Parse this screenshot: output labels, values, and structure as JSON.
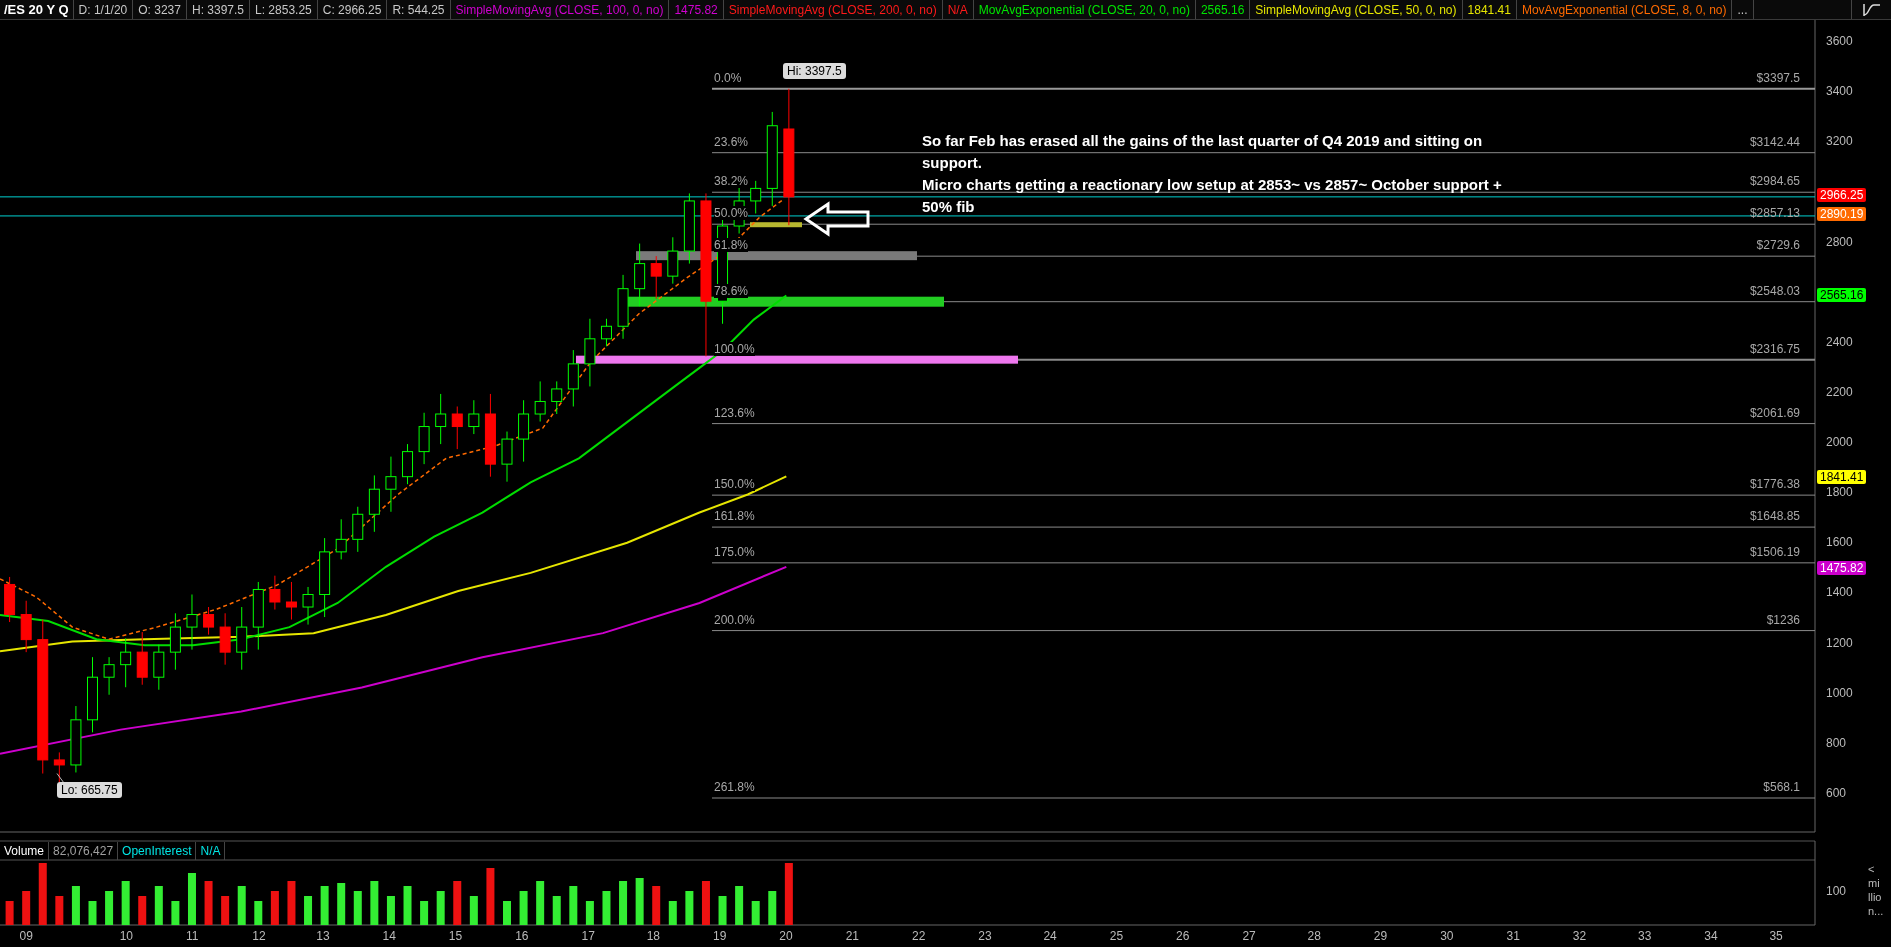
{
  "header": {
    "symbol": "/ES 20 Y Q",
    "items": [
      {
        "text": "D: 1/1/20",
        "color": "#c8c8c8"
      },
      {
        "text": "O: 3237",
        "color": "#c8c8c8"
      },
      {
        "text": "H: 3397.5",
        "color": "#c8c8c8"
      },
      {
        "text": "L: 2853.25",
        "color": "#c8c8c8"
      },
      {
        "text": "C: 2966.25",
        "color": "#c8c8c8"
      },
      {
        "text": "R: 544.25",
        "color": "#c8c8c8"
      },
      {
        "text": "SimpleMovingAvg (CLOSE, 100, 0, no)",
        "color": "#d000d0"
      },
      {
        "text": "1475.82",
        "color": "#d000d0"
      },
      {
        "text": "SimpleMovingAvg (CLOSE, 200, 0, no)",
        "color": "#ff1a1a"
      },
      {
        "text": "N/A",
        "color": "#ff1a1a"
      },
      {
        "text": "MovAvgExponential (CLOSE, 20, 0, no)",
        "color": "#00e600"
      },
      {
        "text": "2565.16",
        "color": "#00e600"
      },
      {
        "text": "SimpleMovingAvg (CLOSE, 50, 0, no)",
        "color": "#e6e600"
      },
      {
        "text": "1841.41",
        "color": "#e6e600"
      },
      {
        "text": "MovAvgExponential (CLOSE, 8, 0, no)",
        "color": "#ff6a00"
      }
    ],
    "more": "..."
  },
  "price_axis": {
    "ticks": [
      "3600",
      "3400",
      "3200",
      "2800",
      "2400",
      "2200",
      "2000",
      "1800",
      "1600",
      "1400",
      "1200",
      "1000",
      "800",
      "600"
    ]
  },
  "price_tags": [
    {
      "text": "2966.25",
      "color": "#ff0000"
    },
    {
      "text": "2890.19",
      "color": "#ff6a00"
    },
    {
      "text": "2565.16",
      "color": "#00ff00"
    },
    {
      "text": "1841.41",
      "color": "#ffff00"
    },
    {
      "text": "1475.82",
      "color": "#cc00cc"
    }
  ],
  "fib_levels": [
    {
      "percent": "0.0%",
      "price": "$3397.5"
    },
    {
      "percent": "23.6%",
      "price": "$3142.44"
    },
    {
      "percent": "38.2%",
      "price": "$2984.65"
    },
    {
      "percent": "50.0%",
      "price": "$2857.13"
    },
    {
      "percent": "61.8%",
      "price": "$2729.6"
    },
    {
      "percent": "78.6%",
      "price": "$2548.03"
    },
    {
      "percent": "100.0%",
      "price": "$2316.75"
    },
    {
      "percent": "123.6%",
      "price": "$2061.69"
    },
    {
      "percent": "150.0%",
      "price": "$1776.38"
    },
    {
      "percent": "161.8%",
      "price": "$1648.85"
    },
    {
      "percent": "175.0%",
      "price": "$1506.19"
    },
    {
      "percent": "200.0%",
      "price": "$1236"
    },
    {
      "percent": "261.8%",
      "price": "$568.1"
    }
  ],
  "labels": {
    "high": "Hi: 3397.5",
    "low": "Lo: 665.75"
  },
  "note": [
    "So far Feb has erased all the gains of the last quarter of Q4 2019 and sitting on support.",
    "Micro charts getting a reactionary low setup at 2853~ vs 2857~ October support + 50% fib"
  ],
  "volume": {
    "items": [
      {
        "text": "Volume",
        "color": "#ffffff"
      },
      {
        "text": "82,076,427",
        "color": "#a0a0a0"
      },
      {
        "text": "OpenInterest",
        "color": "#00e5e5"
      },
      {
        "text": "N/A",
        "color": "#00e5e5"
      }
    ],
    "axis_tick": "100",
    "unit": "<million..."
  },
  "time_axis": [
    "09",
    "10",
    "11",
    "12",
    "13",
    "14",
    "15",
    "16",
    "17",
    "18",
    "19",
    "20",
    "21",
    "22",
    "23",
    "24",
    "25",
    "26",
    "27",
    "28",
    "29",
    "30",
    "31",
    "32",
    "33",
    "34",
    "35"
  ]
}
